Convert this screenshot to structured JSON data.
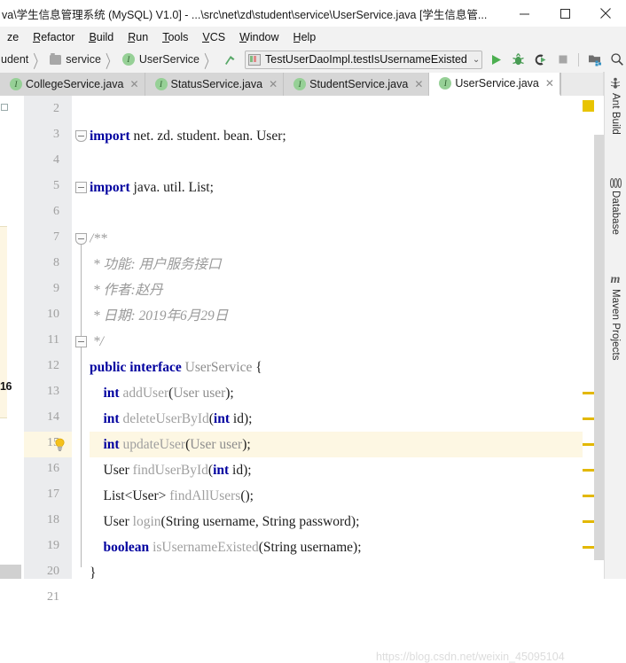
{
  "window": {
    "title": "va\\学生信息管理系统 (MySQL) V1.0] - ...\\src\\net\\zd\\student\\service\\UserService.java [学生信息管...",
    "minimize_label": "─",
    "maximize_label": "☐",
    "close_label": "✕"
  },
  "menubar": {
    "items": [
      {
        "name": "analyze",
        "label": "ze",
        "mnemonic": false
      },
      {
        "name": "refactor",
        "label": "Refactor",
        "mnemonic": true
      },
      {
        "name": "build",
        "label": "Build",
        "mnemonic": true
      },
      {
        "name": "run",
        "label": "Run",
        "mnemonic": true
      },
      {
        "name": "tools",
        "label": "Tools",
        "mnemonic": true
      },
      {
        "name": "vcs",
        "label": "VCS",
        "mnemonic": true
      },
      {
        "name": "window",
        "label": "Window",
        "mnemonic": true
      },
      {
        "name": "help",
        "label": "Help",
        "mnemonic": true
      }
    ]
  },
  "navbar": {
    "breadcrumb": [
      {
        "name": "student",
        "label": "udent",
        "icon": "none"
      },
      {
        "name": "service",
        "label": "service",
        "icon": "folder-icon"
      },
      {
        "name": "userservice",
        "label": "UserService",
        "icon": "interface-icon"
      }
    ],
    "breadcrumb_separator": "〉",
    "run_config": {
      "label": "TestUserDaoImpl.testIsUsernameExisted",
      "chevron": "⌄",
      "icon": "junit-config-icon"
    },
    "buttons": [
      {
        "name": "run-button",
        "icon": "run-triangle-icon",
        "color": "#4caf50"
      },
      {
        "name": "debug-button",
        "icon": "debug-bug-icon",
        "color": "#499c54"
      },
      {
        "name": "run-coverage-button",
        "icon": "coverage-icon",
        "color": "#3b3b3b"
      },
      {
        "name": "stop-button",
        "icon": "stop-square-icon",
        "color": "#a6a6a6"
      },
      {
        "name": "project-structure-button",
        "icon": "project-structure-icon",
        "color": "#6e6e6e"
      },
      {
        "name": "search-everywhere-button",
        "icon": "search-icon",
        "color": "#3c3c3c"
      }
    ]
  },
  "tabs": [
    {
      "name": "tab-collegeservice",
      "label": "CollegeService.java",
      "active": false,
      "close": "✕"
    },
    {
      "name": "tab-statusservice",
      "label": "StatusService.java",
      "active": false,
      "close": "✕"
    },
    {
      "name": "tab-studentservice",
      "label": "StudentService.java",
      "active": false,
      "close": "✕"
    },
    {
      "name": "tab-userservice",
      "label": "UserService.java",
      "active": true,
      "close": "✕"
    }
  ],
  "editor": {
    "first_line": 2,
    "current_line": 15,
    "left_popup_number": "16",
    "line_numbers": [
      2,
      3,
      4,
      5,
      6,
      7,
      8,
      9,
      10,
      11,
      12,
      13,
      14,
      15,
      16,
      17,
      18,
      19,
      20,
      21
    ],
    "lines": [
      {
        "n": 2,
        "segments": []
      },
      {
        "n": 3,
        "segments": [
          {
            "t": "import ",
            "c": "kw"
          },
          {
            "t": "net. zd. student. bean. User;",
            "c": "pl"
          }
        ]
      },
      {
        "n": 4,
        "segments": []
      },
      {
        "n": 5,
        "segments": [
          {
            "t": "import ",
            "c": "kw"
          },
          {
            "t": "java. util. List;",
            "c": "pl"
          }
        ]
      },
      {
        "n": 6,
        "segments": []
      },
      {
        "n": 7,
        "segments": [
          {
            "t": "/**",
            "c": "cm"
          }
        ]
      },
      {
        "n": 8,
        "segments": [
          {
            "t": " * 功能: 用户服务接口",
            "c": "cm"
          }
        ]
      },
      {
        "n": 9,
        "segments": [
          {
            "t": " * 作者:赵丹",
            "c": "cm"
          }
        ]
      },
      {
        "n": 10,
        "segments": [
          {
            "t": " * 日期: 2019年6月29日",
            "c": "cm"
          }
        ]
      },
      {
        "n": 11,
        "segments": [
          {
            "t": " */",
            "c": "cm"
          }
        ]
      },
      {
        "n": 12,
        "segments": [
          {
            "t": "public interface ",
            "c": "kw"
          },
          {
            "t": "UserService",
            "c": "typ"
          },
          {
            "t": " {",
            "c": "pl"
          }
        ]
      },
      {
        "n": 13,
        "segments": [
          {
            "t": "    ",
            "c": "pl"
          },
          {
            "t": "int ",
            "c": "kw"
          },
          {
            "t": "addUser",
            "c": "mth"
          },
          {
            "t": "(",
            "c": "pl"
          },
          {
            "t": "User user",
            "c": "typ"
          },
          {
            "t": ");",
            "c": "pl"
          }
        ]
      },
      {
        "n": 14,
        "segments": [
          {
            "t": "    ",
            "c": "pl"
          },
          {
            "t": "int ",
            "c": "kw"
          },
          {
            "t": "deleteUserById",
            "c": "mth"
          },
          {
            "t": "(",
            "c": "pl"
          },
          {
            "t": "int",
            "c": "kw"
          },
          {
            "t": " id);",
            "c": "pl"
          }
        ]
      },
      {
        "n": 15,
        "segments": [
          {
            "t": "    ",
            "c": "pl"
          },
          {
            "t": "int ",
            "c": "kw"
          },
          {
            "t": "updateUser",
            "c": "mth"
          },
          {
            "t": "(",
            "c": "pl"
          },
          {
            "t": "User user",
            "c": "typ"
          },
          {
            "t": ");",
            "c": "pl"
          }
        ]
      },
      {
        "n": 16,
        "segments": [
          {
            "t": "    ",
            "c": "pl"
          },
          {
            "t": "User ",
            "c": "pl"
          },
          {
            "t": "findUserById",
            "c": "mth"
          },
          {
            "t": "(",
            "c": "pl"
          },
          {
            "t": "int",
            "c": "kw"
          },
          {
            "t": " id);",
            "c": "pl"
          }
        ]
      },
      {
        "n": 17,
        "segments": [
          {
            "t": "    ",
            "c": "pl"
          },
          {
            "t": "List<User> ",
            "c": "pl"
          },
          {
            "t": "findAllUsers",
            "c": "mth"
          },
          {
            "t": "();",
            "c": "pl"
          }
        ]
      },
      {
        "n": 18,
        "segments": [
          {
            "t": "    ",
            "c": "pl"
          },
          {
            "t": "User ",
            "c": "pl"
          },
          {
            "t": "login",
            "c": "mth"
          },
          {
            "t": "(String username, String password);",
            "c": "pl"
          }
        ]
      },
      {
        "n": 19,
        "segments": [
          {
            "t": "    ",
            "c": "pl"
          },
          {
            "t": "boolean ",
            "c": "kw"
          },
          {
            "t": "isUsernameExisted",
            "c": "mth"
          },
          {
            "t": "(String username);",
            "c": "pl"
          }
        ]
      },
      {
        "n": 20,
        "segments": [
          {
            "t": "}",
            "c": "pl"
          }
        ]
      },
      {
        "n": 21,
        "segments": []
      }
    ],
    "fold_markers": [
      {
        "line": 3,
        "shape": "rounded"
      },
      {
        "line": 5,
        "shape": "square"
      },
      {
        "line": 7,
        "shape": "rounded"
      },
      {
        "line": 11,
        "shape": "square"
      }
    ],
    "bulb_line": 15,
    "bulb_icon": "lightbulb-intention-icon"
  },
  "markers": {
    "top_square_color": "#e8c400",
    "tick_color": "#e3b800",
    "tick_lines": [
      13,
      14,
      15,
      16,
      17,
      18,
      19
    ]
  },
  "right_toolwindows": [
    {
      "name": "tool-ant-build",
      "label": "Ant Build",
      "icon": "ant-icon",
      "glyph": "⚘"
    },
    {
      "name": "tool-database",
      "label": "Database",
      "icon": "database-icon",
      "glyph": "⎓"
    },
    {
      "name": "tool-maven-projects",
      "label": "Maven Projects",
      "icon": "maven-icon",
      "glyph": "m"
    }
  ],
  "watermark": {
    "text": "https://blog.csdn.net/weixin_45095104"
  }
}
